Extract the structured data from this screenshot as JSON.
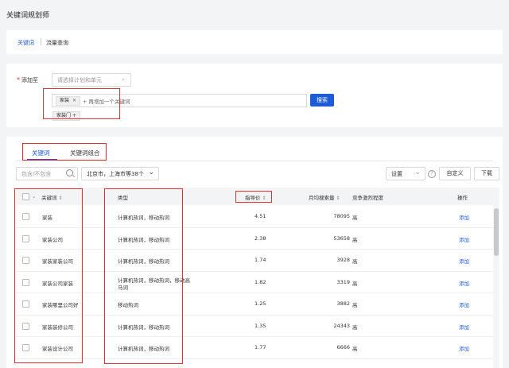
{
  "page": {
    "title": "关键词规划师"
  },
  "top_tabs": [
    {
      "label": "关键词"
    },
    {
      "label": "流量查询"
    }
  ],
  "add_form": {
    "required_mark": "*",
    "label": "添加至",
    "plan_select_placeholder": "请选择计划和单元",
    "keyword_tag": "家装",
    "keyword_add_placeholder": "+ 再增加一个关键词",
    "search_button": "搜索",
    "keyword_tag2": "家装门",
    "keyword_tag2_add": "+"
  },
  "result_tabs": [
    {
      "label": "关键词"
    },
    {
      "label": "关键词组合"
    }
  ],
  "toolbar": {
    "filter_placeholder": "包含/不包含",
    "region_value": "北京市，上海市等38个",
    "settings_label": "设置",
    "help_icon": "?",
    "customize_button": "自定义",
    "download_button": "下载"
  },
  "table": {
    "headers": {
      "keyword": "关键词",
      "type": "类型",
      "price": "指导价",
      "monthly": "月均搜索量",
      "competition": "竞争激烈程度",
      "action": "操作"
    },
    "rows": [
      {
        "keyword": "家装",
        "type": "计算机热词，移动热词",
        "price": "4.51",
        "monthly": "78095",
        "competition": "高",
        "action": "添加"
      },
      {
        "keyword": "家装公司",
        "type": "计算机热词，移动热词",
        "price": "2.38",
        "monthly": "53658",
        "competition": "高",
        "action": "添加"
      },
      {
        "keyword": "家装家装公司",
        "type": "计算机热词，移动热词",
        "price": "1.74",
        "monthly": "3928",
        "competition": "高",
        "action": "添加"
      },
      {
        "keyword": "家装公司家装",
        "type": "计算机热词，移动热词，移动高",
        "type2": "马词",
        "price": "1.82",
        "monthly": "3319",
        "competition": "高",
        "action": "添加"
      },
      {
        "keyword": "家装哪里公司好",
        "type": "移动热词",
        "price": "1.25",
        "monthly": "3882",
        "competition": "高",
        "action": "添加"
      },
      {
        "keyword": "家装装修公司",
        "type": "计算机热词，移动热词",
        "price": "1.35",
        "monthly": "24343",
        "competition": "高",
        "action": "添加"
      },
      {
        "keyword": "家装设计公司",
        "type": "计算机热词，移动热词",
        "price": "1.77",
        "monthly": "6666",
        "competition": "高",
        "action": "添加"
      }
    ]
  },
  "colors": {
    "accent": "#1e5bd8",
    "highlight": "#e0332f"
  }
}
